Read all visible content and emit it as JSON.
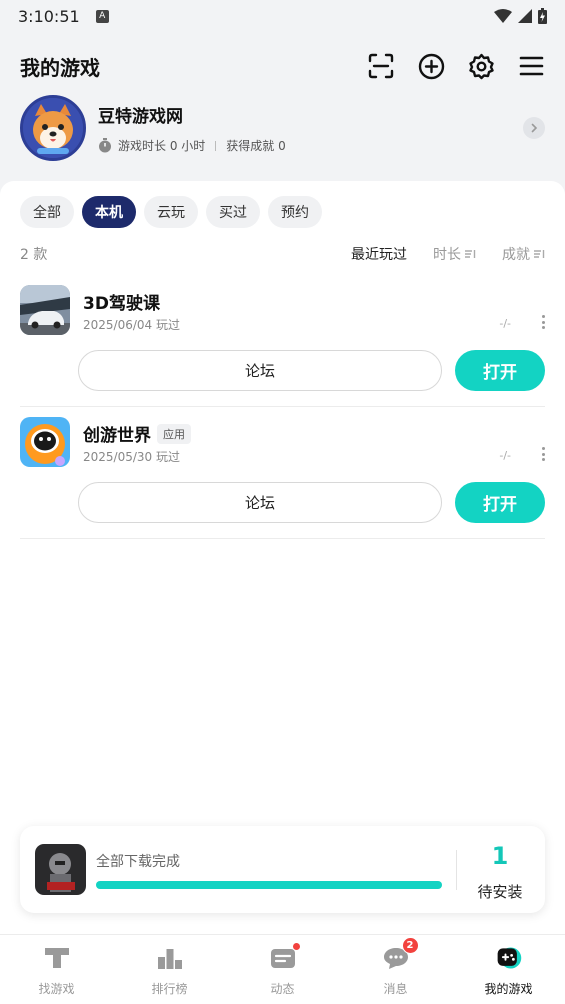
{
  "status_bar": {
    "time": "3:10:51"
  },
  "header": {
    "title": "我的游戏"
  },
  "profile": {
    "name": "豆特游戏网",
    "play_time": "游戏时长 0 小时",
    "achievements": "获得成就 0"
  },
  "tabs": [
    {
      "label": "全部",
      "active": false
    },
    {
      "label": "本机",
      "active": true
    },
    {
      "label": "云玩",
      "active": false
    },
    {
      "label": "买过",
      "active": false
    },
    {
      "label": "预约",
      "active": false
    }
  ],
  "list": {
    "count": "2 款",
    "sort_options": [
      "最近玩过",
      "时长",
      "成就"
    ]
  },
  "games": [
    {
      "name": "3D驾驶课",
      "tag": "",
      "last_played": "2025/06/04 玩过",
      "rating": "-/-",
      "forum_label": "论坛",
      "open_label": "打开"
    },
    {
      "name": "创游世界",
      "tag": "应用",
      "last_played": "2025/05/30 玩过",
      "rating": "-/-",
      "forum_label": "论坛",
      "open_label": "打开"
    }
  ],
  "download": {
    "status_text": "全部下载完成",
    "progress": 1.0,
    "pending_count": "1",
    "pending_label": "待安装"
  },
  "bottom_nav": [
    {
      "label": "找游戏",
      "icon": "find-game-icon",
      "active": false
    },
    {
      "label": "排行榜",
      "icon": "ranking-icon",
      "active": false
    },
    {
      "label": "动态",
      "icon": "feed-icon",
      "active": false
    },
    {
      "label": "消息",
      "icon": "message-icon",
      "active": false,
      "badge": "2"
    },
    {
      "label": "我的游戏",
      "icon": "my-games-icon",
      "active": true
    }
  ],
  "colors": {
    "accent": "#13d3c3",
    "active_tab": "#1d2a6b",
    "badge": "#f2423e"
  }
}
